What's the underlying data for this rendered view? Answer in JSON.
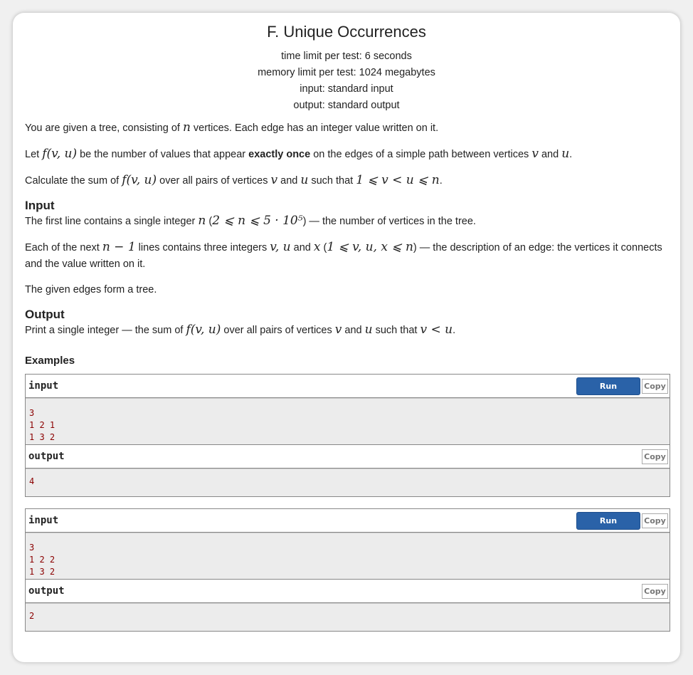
{
  "problem": {
    "title": "F. Unique Occurrences",
    "limits": [
      "time limit per test: 6 seconds",
      "memory limit per test: 1024 megabytes",
      "input: standard input",
      "output: standard output"
    ]
  },
  "statement": [
    [
      {
        "t": "You are given a tree, consisting of "
      },
      {
        "m": "n"
      },
      {
        "t": " vertices. Each edge has an integer value written on it."
      }
    ],
    [
      {
        "t": "Let "
      },
      {
        "m": "f(v, u)"
      },
      {
        "t": " be the number of values that appear "
      },
      {
        "b": "exactly once"
      },
      {
        "t": " on the edges of a simple path between vertices "
      },
      {
        "m": "v"
      },
      {
        "t": " and "
      },
      {
        "m": "u"
      },
      {
        "t": "."
      }
    ],
    [
      {
        "t": "Calculate the sum of "
      },
      {
        "m": "f(v, u)"
      },
      {
        "t": " over all pairs of vertices "
      },
      {
        "m": "v"
      },
      {
        "t": " and "
      },
      {
        "m": "u"
      },
      {
        "t": " such that "
      },
      {
        "m": "1 ⩽ v < u ⩽ n"
      },
      {
        "t": "."
      }
    ]
  ],
  "input_section": {
    "heading": "Input",
    "paragraphs": [
      [
        {
          "t": "The first line contains a single integer "
        },
        {
          "m": "n"
        },
        {
          "t": " ("
        },
        {
          "m": "2 ⩽ n ⩽ 5 · 10⁵"
        },
        {
          "t": ") — the number of vertices in the tree."
        }
      ],
      [
        {
          "t": "Each of the next "
        },
        {
          "m": "n − 1"
        },
        {
          "t": " lines contains three integers "
        },
        {
          "m": "v, u"
        },
        {
          "t": " and "
        },
        {
          "m": "x"
        },
        {
          "t": " ("
        },
        {
          "m": "1 ⩽ v, u, x ⩽ n"
        },
        {
          "t": ") — the description of an edge: the vertices it connects and the value written on it."
        }
      ],
      [
        {
          "t": "The given edges form a tree."
        }
      ]
    ]
  },
  "output_section": {
    "heading": "Output",
    "paragraphs": [
      [
        {
          "t": "Print a single integer — the sum of "
        },
        {
          "m": "f(v, u)"
        },
        {
          "t": " over all pairs of vertices "
        },
        {
          "m": "v"
        },
        {
          "t": " and "
        },
        {
          "m": "u"
        },
        {
          "t": " such that "
        },
        {
          "m": "v < u"
        },
        {
          "t": "."
        }
      ]
    ]
  },
  "examples": {
    "heading": "Examples",
    "input_label": "input",
    "output_label": "output",
    "run_label": "Run",
    "copy_label": "Copy",
    "items": [
      {
        "input": "3\n1 2 1\n1 3 2",
        "output": "4"
      },
      {
        "input": "3\n1 2 2\n1 3 2",
        "output": "2"
      }
    ]
  }
}
